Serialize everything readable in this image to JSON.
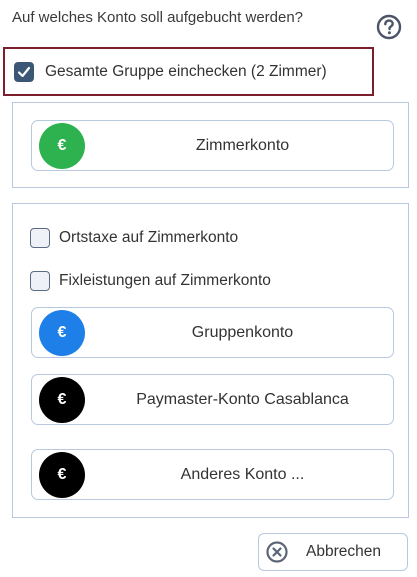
{
  "dialog": {
    "question": "Auf welches Konto soll aufgebucht werden?",
    "help_icon": "help-circle-icon"
  },
  "group_checkin": {
    "label": "Gesamte Gruppe einchecken (2 Zimmer)",
    "checked": true
  },
  "room_account": {
    "label": "Zimmerkonto",
    "icon": "euro-icon",
    "color": "#2eb24f"
  },
  "options": {
    "tourist_tax": {
      "label": "Ortstaxe auf Zimmerkonto",
      "checked": false
    },
    "fixed_services": {
      "label": "Fixleistungen auf Zimmerkonto",
      "checked": false
    }
  },
  "other_accounts": [
    {
      "label": "Gruppenkonto",
      "icon": "euro-icon",
      "color": "#1e7fe8"
    },
    {
      "label": "Paymaster-Konto Casablanca",
      "icon": "euro-icon",
      "color": "#000000"
    },
    {
      "label": "Anderes Konto ...",
      "icon": "euro-icon",
      "color": "#000000"
    }
  ],
  "euro_symbol": "€",
  "cancel": {
    "label": "Abbrechen",
    "icon": "close-circle-icon"
  },
  "colors": {
    "highlight_border": "#7a1f2b",
    "box_border": "#b8c9df",
    "checkbox_checked": "#3c5676"
  }
}
